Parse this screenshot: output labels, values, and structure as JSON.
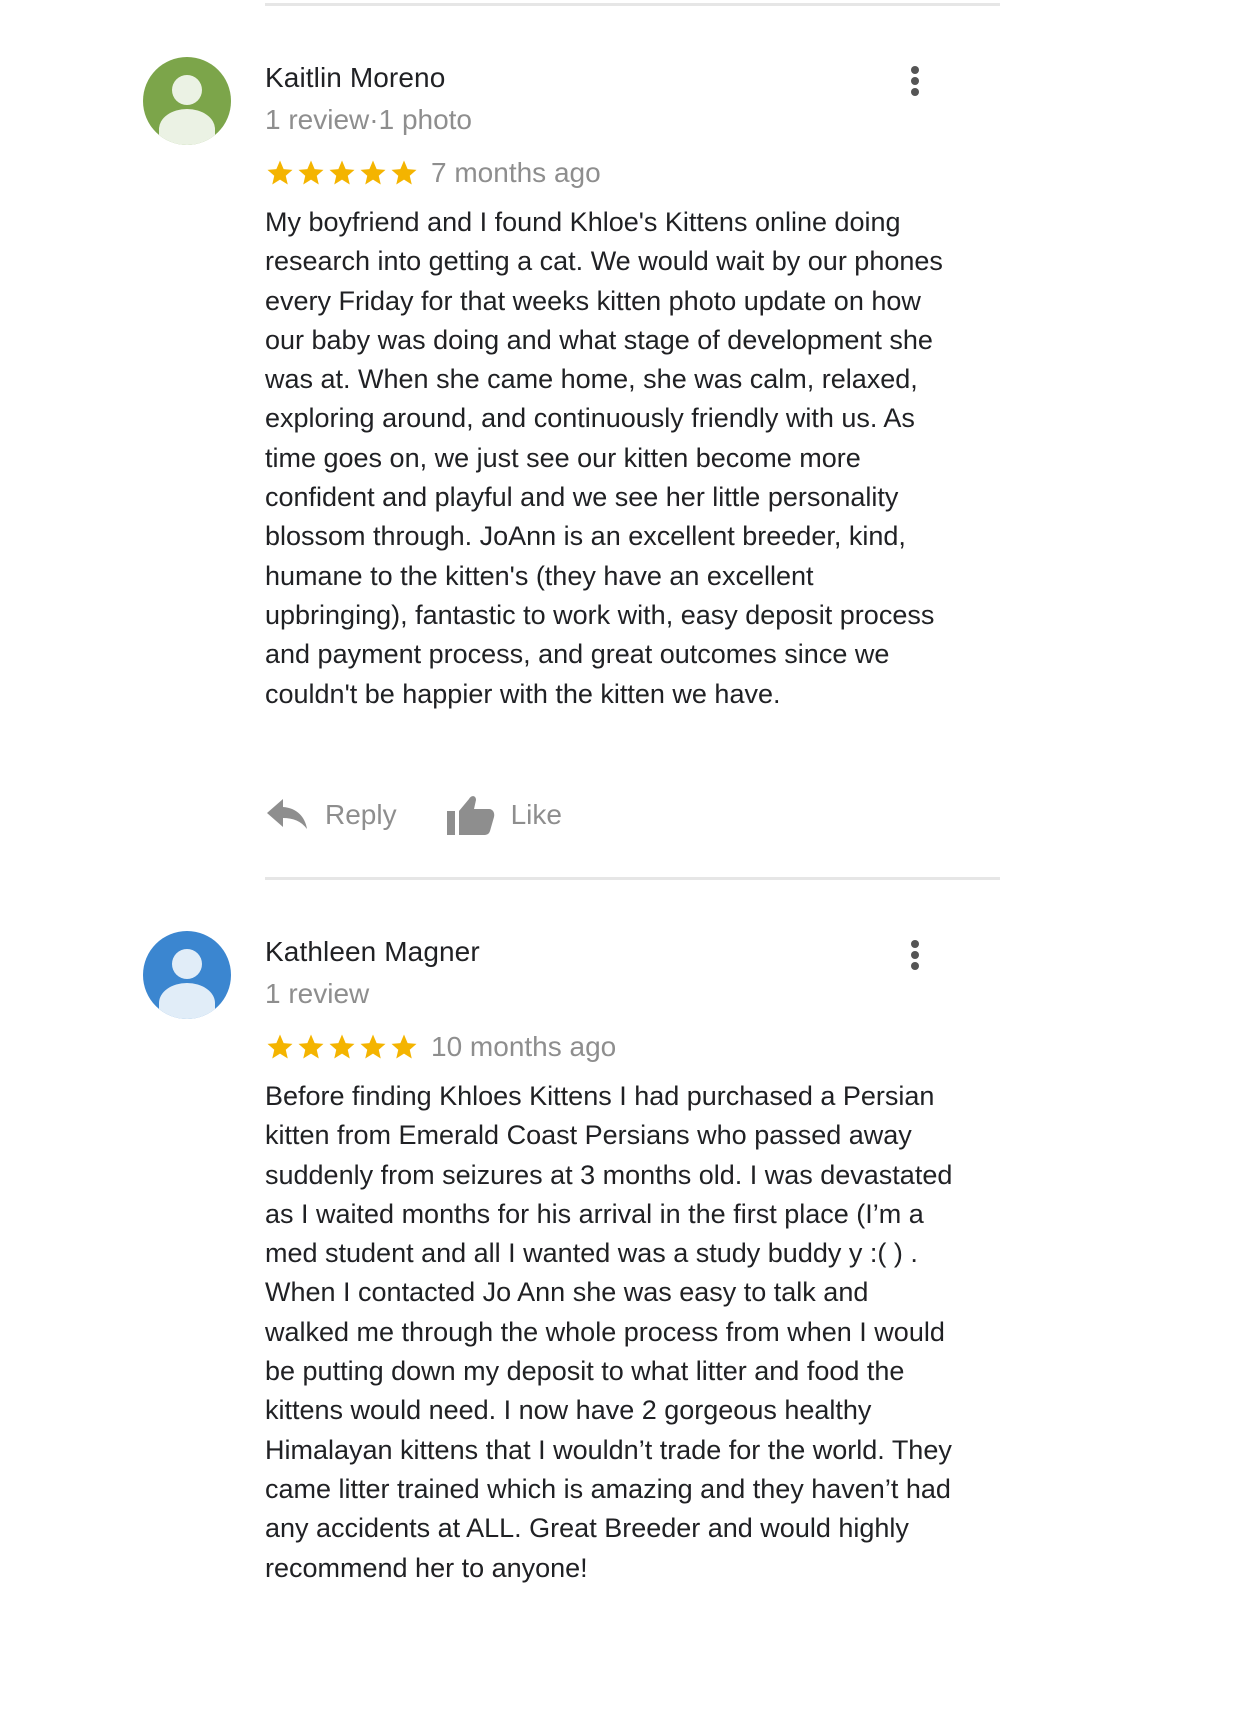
{
  "colors": {
    "star": "#F4B400",
    "avatar_green": "#7CA54A",
    "avatar_blue": "#3B86D0",
    "muted": "#8E8E8E",
    "divider": "#E6E6E6"
  },
  "reviews": [
    {
      "author": "Kaitlin Moreno",
      "meta": "1 review·1 photo",
      "rating": 5,
      "time": "7 months ago",
      "avatar_color": "#7CA54A",
      "text": "My boyfriend and I found Khloe's Kittens online doing research into getting a cat. We would wait by our phones every Friday for that weeks kitten photo update on how our baby was doing and what stage of development she was at. When she came home, she was calm, relaxed, exploring around, and continuously friendly with us. As time goes on, we just see our kitten become more confident and playful and we see her little personality blossom through. JoAnn is an excellent breeder, kind, humane to the kitten's (they have an excellent upbringing), fantastic to work with, easy deposit process and payment process, and great outcomes since we couldn't be happier with the kitten we have.",
      "actions": {
        "reply_label": "Reply",
        "like_label": "Like"
      }
    },
    {
      "author": "Kathleen Magner",
      "meta": "1 review",
      "rating": 5,
      "time": "10 months ago",
      "avatar_color": "#3B86D0",
      "text": "Before finding Khloes Kittens I had purchased a Persian kitten from Emerald Coast Persians who passed away suddenly from seizures at 3 months old. I was devastated as I waited months for his arrival in the first place (I’m a med student and all I wanted was a study buddy y :( ) . When I contacted Jo Ann she was easy to talk and walked me through the whole process from when I would be putting down my deposit to what litter and food the kittens would need. I now have 2 gorgeous healthy Himalayan kittens that I wouldn’t trade for the world. They came litter trained which is amazing and they haven’t had any accidents at ALL. Great Breeder and would highly recommend her to anyone!"
    }
  ]
}
